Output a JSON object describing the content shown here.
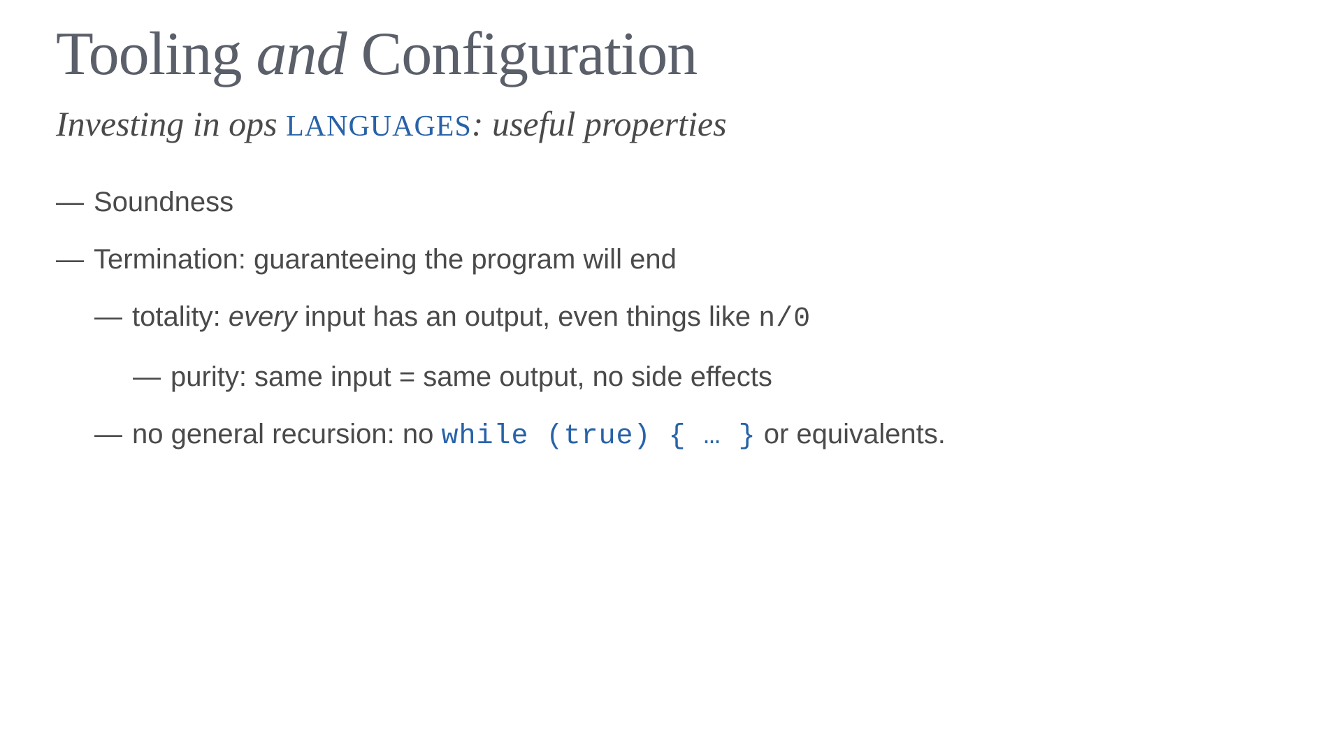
{
  "title": {
    "part1": "Tooling",
    "and": " and ",
    "part2": "Configuration"
  },
  "subtitle": {
    "part1": "Investing in ops ",
    "smallcaps": "languages",
    "part2": ": useful properties"
  },
  "bullets": {
    "b0": "Soundness",
    "b1": "Termination: guaranteeing the program will end",
    "b2_pre": "totality: ",
    "b2_em": "every",
    "b2_post": " input has an output, even things like ",
    "b2_code": "n/0",
    "b3": "purity: same input = same output, no side effects",
    "b4_pre": "no general recursion: no ",
    "b4_code": "while (true) { … }",
    "b4_post": " or equivalents."
  },
  "dash": "—"
}
